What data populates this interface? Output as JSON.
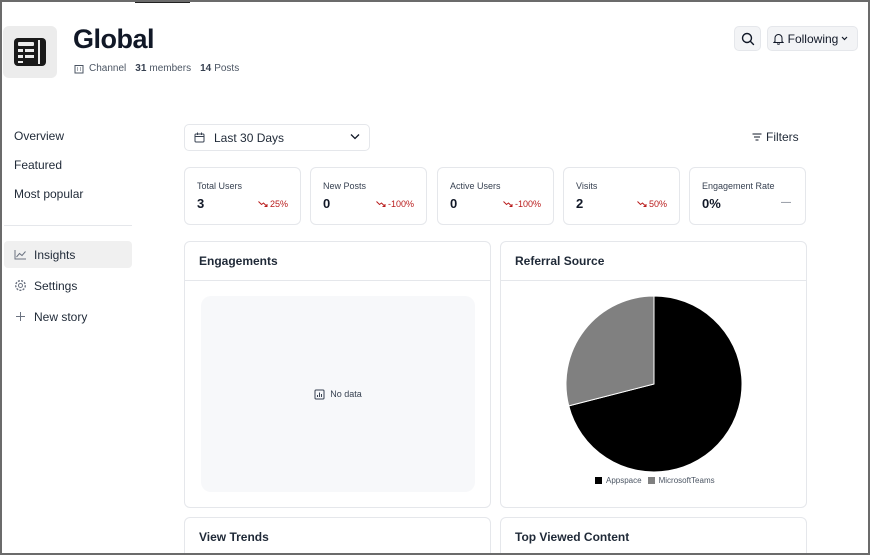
{
  "channel": {
    "title": "Global",
    "type_label": "Channel",
    "members_count": "31",
    "members_label": "members",
    "posts_count": "14",
    "posts_label": "Posts"
  },
  "header": {
    "follow_label": "Following"
  },
  "sidebar": {
    "links": [
      {
        "label": "Overview"
      },
      {
        "label": "Featured"
      },
      {
        "label": "Most popular"
      }
    ],
    "nav": [
      {
        "label": "Insights",
        "icon": "chart-line-icon",
        "active": true
      },
      {
        "label": "Settings",
        "icon": "gear-icon",
        "active": false
      },
      {
        "label": "New story",
        "icon": "plus-icon",
        "active": false
      }
    ]
  },
  "toolbar": {
    "date_range": "Last 30 Days",
    "filters_label": "Filters"
  },
  "stats": [
    {
      "label": "Total Users",
      "value": "3",
      "trend": "25%"
    },
    {
      "label": "New Posts",
      "value": "0",
      "trend": "-100%"
    },
    {
      "label": "Active Users",
      "value": "0",
      "trend": "-100%"
    },
    {
      "label": "Visits",
      "value": "2",
      "trend": "50%"
    },
    {
      "label": "Engagement Rate",
      "value": "0%",
      "trend": "—"
    }
  ],
  "panels": {
    "engagements": {
      "title": "Engagements",
      "empty_text": "No data"
    },
    "referral": {
      "title": "Referral Source"
    },
    "view_trends": {
      "title": "View Trends"
    },
    "top_viewed": {
      "title": "Top Viewed Content"
    }
  },
  "colors": {
    "trend_down": "#b91c1c",
    "active_nav_bg": "#f0f0f0"
  },
  "chart_data": {
    "type": "pie",
    "categories": [
      "Appspace",
      "MicrosoftTeams"
    ],
    "values": [
      71,
      29
    ],
    "colors": [
      "#000000",
      "#808080"
    ],
    "legend": "bottom"
  }
}
